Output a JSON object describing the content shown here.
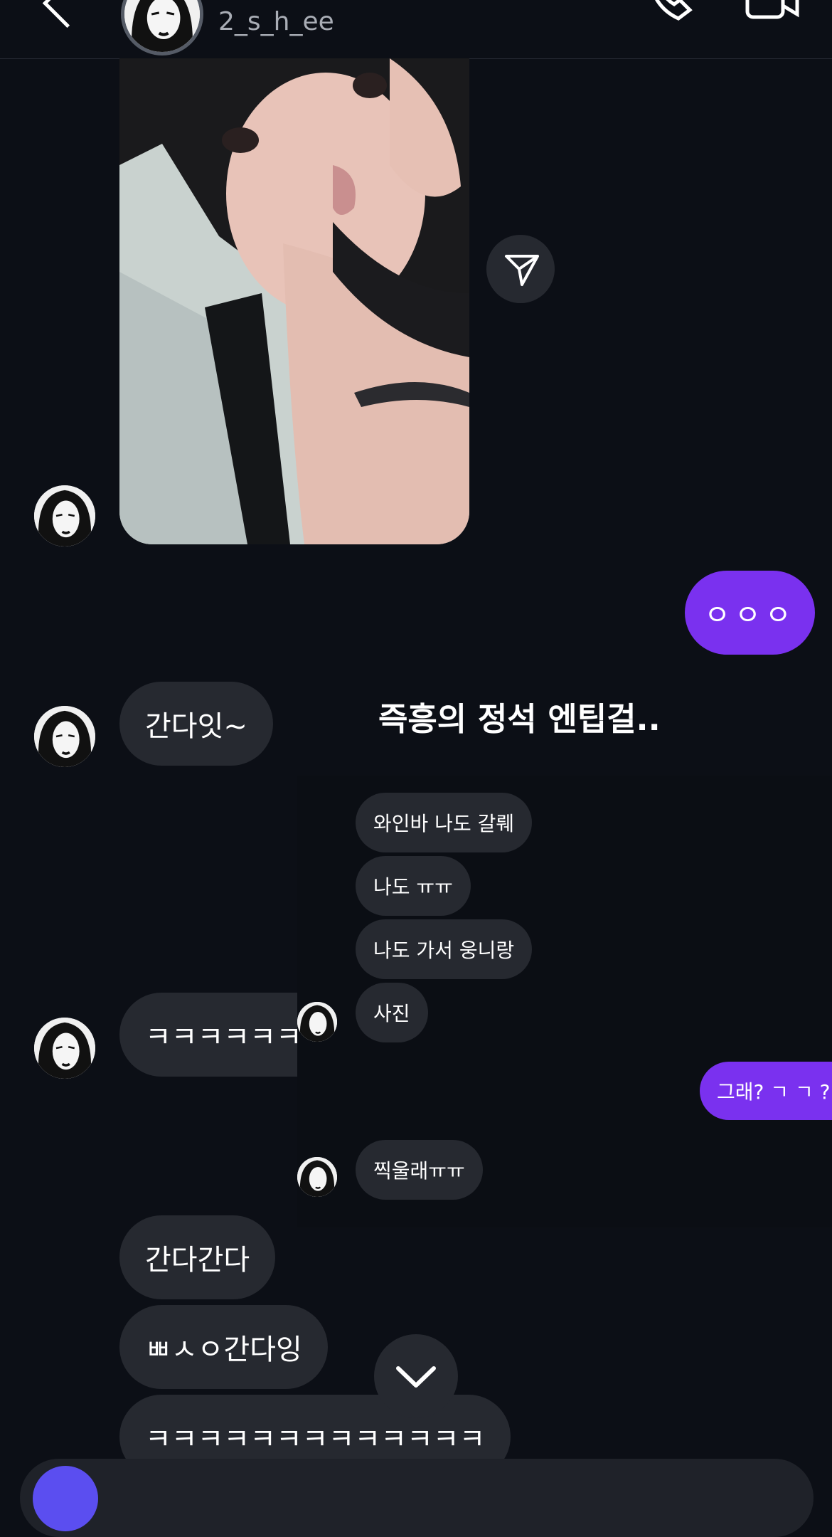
{
  "header": {
    "username": "2_s_h_ee",
    "icons": {
      "back": "chevron-left-icon",
      "call": "phone-icon",
      "video": "video-camera-icon"
    }
  },
  "messages": {
    "sent_dots": "ㅇㅇㅇ",
    "gandait": "간다잇~",
    "kkk_short": "ㅋㅋㅋㅋㅋㅋ",
    "gandaganda": "간다간다",
    "ppaeseung": "ㅃㅅㅇ간다잉",
    "kkk_long": "ㅋㅋㅋㅋㅋㅋㅋㅋㅋㅋㅋㅋㅋ"
  },
  "embedded": {
    "title": "즉흥의 정석 엔팁걸..",
    "msgs": [
      "와인바 나도 갈뤠",
      "나도 ㅠㅠ",
      "나도 가서 웅니랑",
      "사진"
    ],
    "sent": "그래? ㄱ ㄱ ?",
    "last": "찍울래ㅠㅠ"
  },
  "colors": {
    "background": "#0c0f16",
    "bubble_received": "#262930",
    "bubble_sent": "#7a31ef"
  }
}
